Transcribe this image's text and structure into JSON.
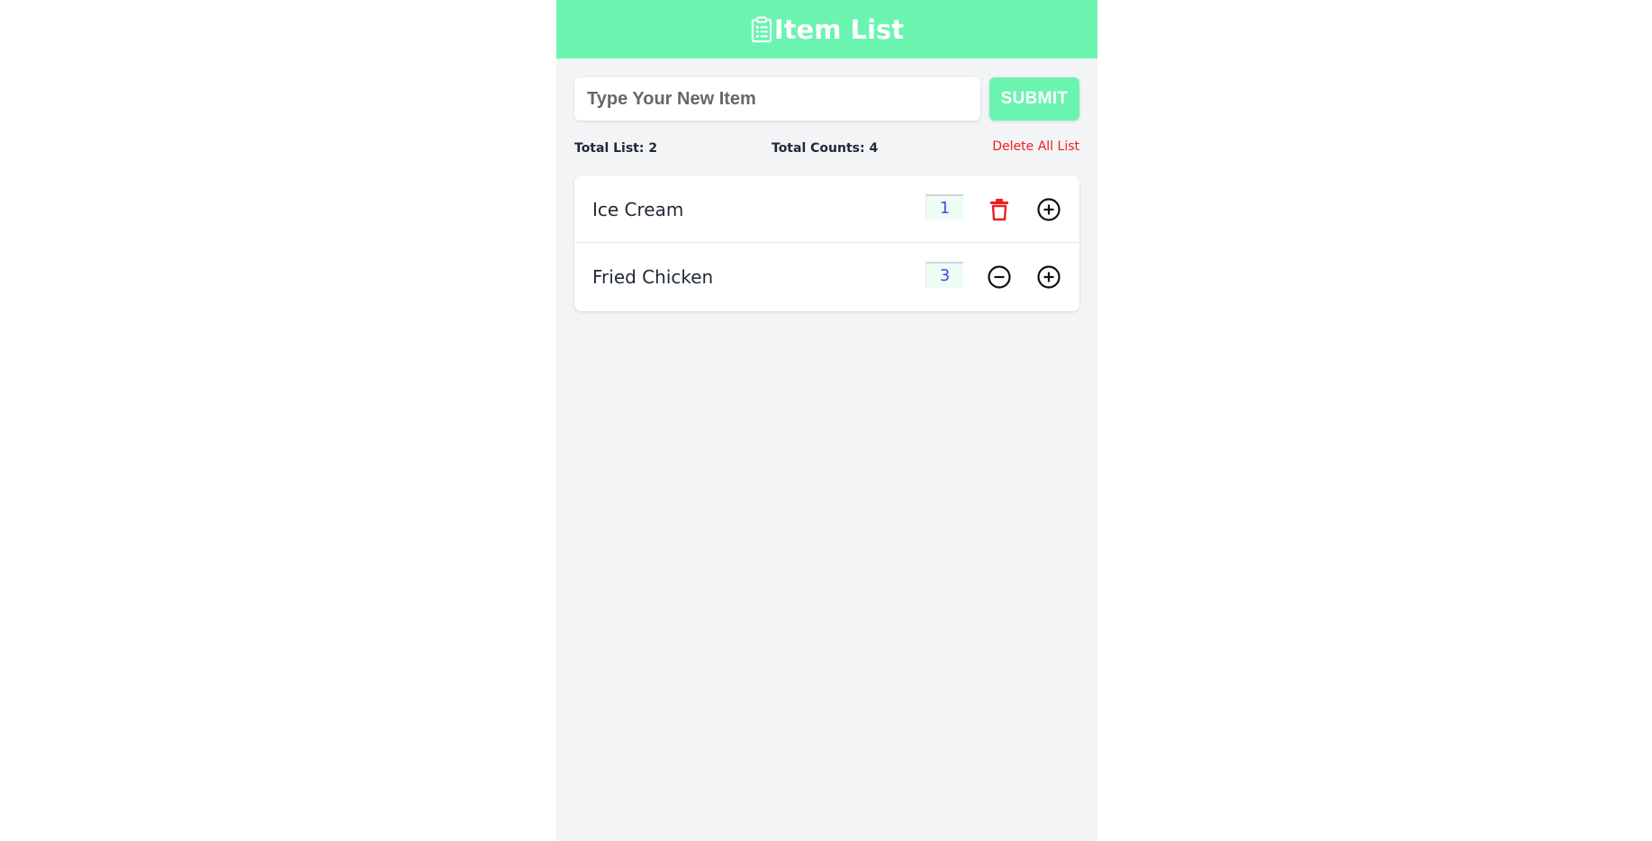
{
  "header": {
    "title": "Item List",
    "icon": "clipboard-list-icon"
  },
  "form": {
    "input_placeholder": "Type Your New Item",
    "input_value": "",
    "submit_label": "SUBMIT"
  },
  "stats": {
    "total_list_label": "Total List: 2",
    "total_counts_label": "Total Counts: 4",
    "delete_all_label": "Delete All List"
  },
  "items": [
    {
      "name": "Ice Cream",
      "count": "1",
      "action_icon": "trash-icon",
      "plus_icon": "plus-circle-icon"
    },
    {
      "name": "Fried Chicken",
      "count": "3",
      "action_icon": "minus-circle-icon",
      "plus_icon": "plus-circle-icon"
    }
  ],
  "colors": {
    "accent": "#6af4b0",
    "danger": "#ef1f1f",
    "count_text": "#4f46e5",
    "background": "#f3f4f6"
  }
}
